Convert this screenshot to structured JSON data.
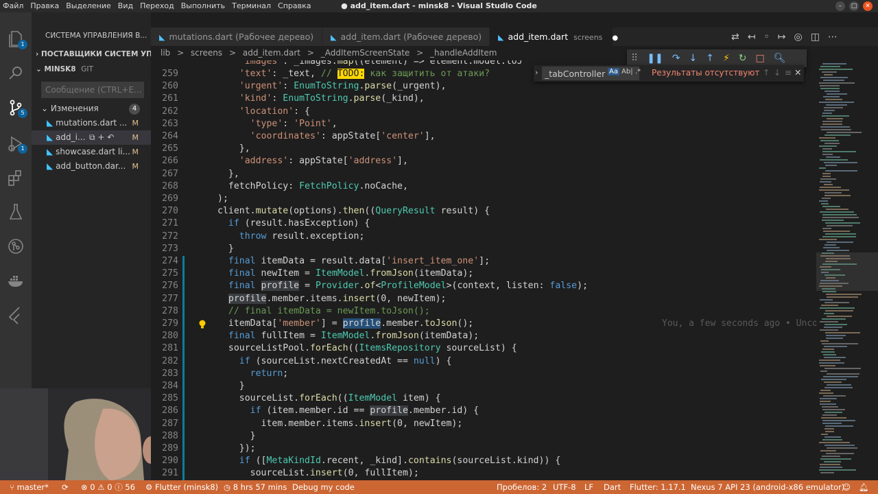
{
  "window": {
    "title": "add_item.dart - minsk8 - Visual Studio Code",
    "menu": [
      "Файл",
      "Правка",
      "Выделение",
      "Вид",
      "Переход",
      "Выполнить",
      "Терминал",
      "Справка"
    ]
  },
  "activity": {
    "explorer_badge": "1",
    "scm_badge": "5"
  },
  "sidebar": {
    "header": "СИСТЕМА УПРАВЛЕНИЯ В...",
    "providers": "ПОСТАВЩИКИ СИСТЕМ УП...",
    "repo_name": "MINSK8",
    "repo_type": "GIT",
    "commit_placeholder": "Сообщение (CTRL+E...",
    "changes_label": "Изменения",
    "changes_count": "4",
    "files": [
      {
        "name": "mutations.dart ...",
        "status": "M"
      },
      {
        "name": "add_i...",
        "status": "M"
      },
      {
        "name": "showcase.dart li...",
        "status": "M"
      },
      {
        "name": "add_button.dar...",
        "status": "M"
      }
    ]
  },
  "tabs": [
    {
      "label": "mutations.dart (Рабочее дерево)"
    },
    {
      "label": "add_item.dart (Рабочее дерево)",
      "marker": "●"
    },
    {
      "label": "add_item.dart",
      "detail": "screens",
      "marker": "●"
    }
  ],
  "breadcrumb": [
    "lib",
    ">",
    "screens",
    ">",
    "add_item.dart",
    ">",
    "_AddItemScreenState",
    ">",
    "_handleAddItem"
  ],
  "find": {
    "value": "_tabController",
    "option_case": "Aa",
    "option_word": "Ab|",
    "option_regex": ".*",
    "result": "Результаты отсутствуют"
  },
  "editor": {
    "lines": [
      {
        "n": "259",
        "html": "    <span class=\"str\">'text'</span>: _text, <span class=\"cm\">// <span class=\"todo\">TODO:</span> как защитить от атаки?</span>"
      },
      {
        "n": "260",
        "html": "    <span class=\"str\">'urgent'</span>: <span class=\"ty\">EnumToString</span>.<span class=\"fn\">parse</span>(_urgent),"
      },
      {
        "n": "261",
        "html": "    <span class=\"str\">'kind'</span>: <span class=\"ty\">EnumToString</span>.<span class=\"fn\">parse</span>(_kind),"
      },
      {
        "n": "262",
        "html": "    <span class=\"str\">'location'</span>: {"
      },
      {
        "n": "263",
        "html": "      <span class=\"str\">'type'</span>: <span class=\"str\">'Point'</span>,"
      },
      {
        "n": "264",
        "html": "      <span class=\"str\">'coordinates'</span>: appState[<span class=\"str\">'center'</span>],"
      },
      {
        "n": "265",
        "html": "    },"
      },
      {
        "n": "266",
        "html": "    <span class=\"str\">'address'</span>: appState[<span class=\"str\">'address'</span>],"
      },
      {
        "n": "267",
        "html": "  },"
      },
      {
        "n": "268",
        "html": "  fetchPolicy: <span class=\"ty\">FetchPolicy</span>.noCache,"
      },
      {
        "n": "269",
        "html": ");"
      },
      {
        "n": "270",
        "html": "client.<span class=\"fn\">mutate</span>(options).<span class=\"fn\">then</span>((<span class=\"ty\">QueryResult</span> result) {"
      },
      {
        "n": "271",
        "html": "  <span class=\"kw\">if</span> (result.hasException) {"
      },
      {
        "n": "272",
        "html": "    <span class=\"kw\">throw</span> result.exception;"
      },
      {
        "n": "273",
        "html": "  }"
      },
      {
        "n": "274",
        "html": "  <span class=\"kw\">final</span> itemData = result.data[<span class=\"str\">'insert_item_one'</span>];"
      },
      {
        "n": "275",
        "html": "  <span class=\"kw\">final</span> newItem = <span class=\"ty\">ItemModel</span>.<span class=\"fn\">fromJson</span>(itemData);"
      },
      {
        "n": "276",
        "html": "  <span class=\"kw\">final</span> <span class=\"hl2\">profile</span> = <span class=\"ty\">Provider</span>.<span class=\"fn\">of</span>&lt;<span class=\"ty\">ProfileModel</span>&gt;(context, listen: <span class=\"kw\">false</span>);"
      },
      {
        "n": "277",
        "html": "  <span class=\"hl2\">profile</span>.member.items.<span class=\"fn\">insert</span>(0, newItem);"
      },
      {
        "n": "278",
        "html": "  <span class=\"cm\">// final itemData = newItem.toJson();</span>"
      },
      {
        "n": "279",
        "html": "  itemData[<span class=\"str\">'member'</span>] = <span class=\"hl\">profile</span>.member.<span class=\"fn\">toJson</span>();"
      },
      {
        "n": "280",
        "html": "  <span class=\"kw\">final</span> fullItem = <span class=\"ty\">ItemModel</span>.<span class=\"fn\">fromJson</span>(itemData);"
      },
      {
        "n": "281",
        "html": "  sourceListPool.<span class=\"fn\">forEach</span>((<span class=\"ty\">ItemsRepository</span> sourceList) {"
      },
      {
        "n": "282",
        "html": "    <span class=\"kw\">if</span> (sourceList.nextCreatedAt == <span class=\"kw\">null</span>) {"
      },
      {
        "n": "283",
        "html": "      <span class=\"kw\">return</span>;"
      },
      {
        "n": "284",
        "html": "    }"
      },
      {
        "n": "285",
        "html": "    sourceList.<span class=\"fn\">forEach</span>((<span class=\"ty\">ItemModel</span> item) {"
      },
      {
        "n": "286",
        "html": "      <span class=\"kw\">if</span> (item.member.id == <span class=\"hl2\">profile</span>.member.id) {"
      },
      {
        "n": "287",
        "html": "        item.member.items.<span class=\"fn\">insert</span>(0, newItem);"
      },
      {
        "n": "288",
        "html": "      }"
      },
      {
        "n": "289",
        "html": "    });"
      },
      {
        "n": "290",
        "html": "    <span class=\"kw\">if</span> ([<span class=\"ty\">MetaKindId</span>.recent, _kind].<span class=\"fn\">contains</span>(sourceList.kind)) {"
      },
      {
        "n": "291",
        "html": "      sourceList.<span class=\"fn\">insert</span>(0, fullItem);"
      }
    ],
    "top_partial_html": "    <span class=\"str\">'images'</span>: _images.<span class=\"fn\">map</span>((element) =&gt; element.model.toJ",
    "blame": "You, a few seconds ago • Uncommitted changes"
  },
  "statusbar": {
    "branch": "master*",
    "errors": "0",
    "warnings": "0",
    "info": "56",
    "flutter": "Flutter (minsk8)",
    "time": "8 hrs 57 mins",
    "debug": "Debug my code",
    "spaces": "Пробелов: 2",
    "encoding": "UTF-8",
    "eol": "LF",
    "language": "Dart",
    "flutter_version": "Flutter: 1.17.1",
    "device": "Nexus 7 API 23 (android-x86 emulator)"
  },
  "colors": {
    "statusbar": "#cc6633",
    "accent": "#0e639c"
  }
}
